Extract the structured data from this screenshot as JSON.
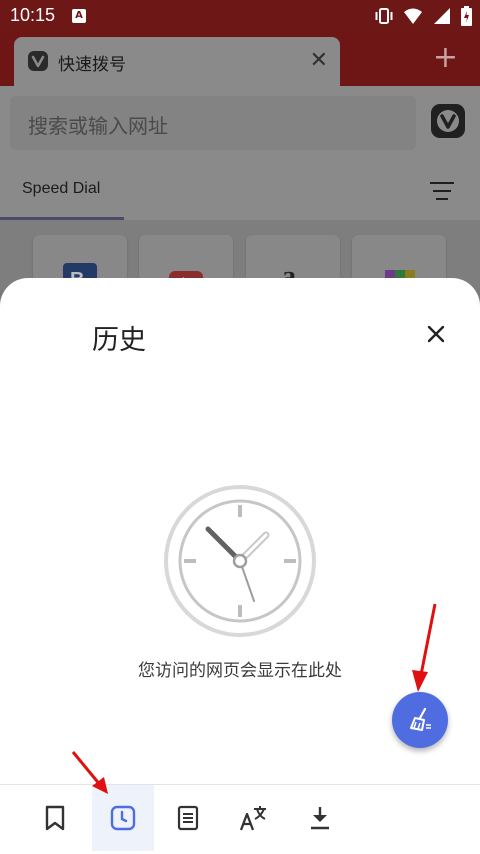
{
  "status_bar": {
    "time": "10:15",
    "notification_icon": "a-icon",
    "icons": [
      "vibrate-icon",
      "wifi-icon",
      "signal-icon",
      "battery-icon"
    ]
  },
  "browser": {
    "tab": {
      "title": "快速拨号",
      "close_icon": "close-icon"
    },
    "new_tab_icon": "plus-icon",
    "search": {
      "placeholder": "搜索或输入网址"
    },
    "speed_dial": {
      "tab_label": "Speed Dial",
      "menu_icon": "sort-icon"
    },
    "tiles": [
      "booking-icon",
      "youtube-icon",
      "amazon-icon",
      "shopping-bag-icon"
    ]
  },
  "history_panel": {
    "title": "历史",
    "close_icon": "close-icon",
    "empty_message": "您访问的网页会显示在此处",
    "clear_button_icon": "broom-icon",
    "accent_color": "#4f6ce0"
  },
  "bottom_nav": {
    "items": [
      {
        "name": "bookmarks",
        "icon": "bookmark-icon",
        "active": false
      },
      {
        "name": "history",
        "icon": "history-clock-icon",
        "active": true
      },
      {
        "name": "notes",
        "icon": "notes-icon",
        "active": false
      },
      {
        "name": "translate",
        "icon": "translate-icon",
        "active": false
      },
      {
        "name": "downloads",
        "icon": "download-icon",
        "active": false
      }
    ]
  },
  "annotations": {
    "arrow_color": "#e01010"
  }
}
